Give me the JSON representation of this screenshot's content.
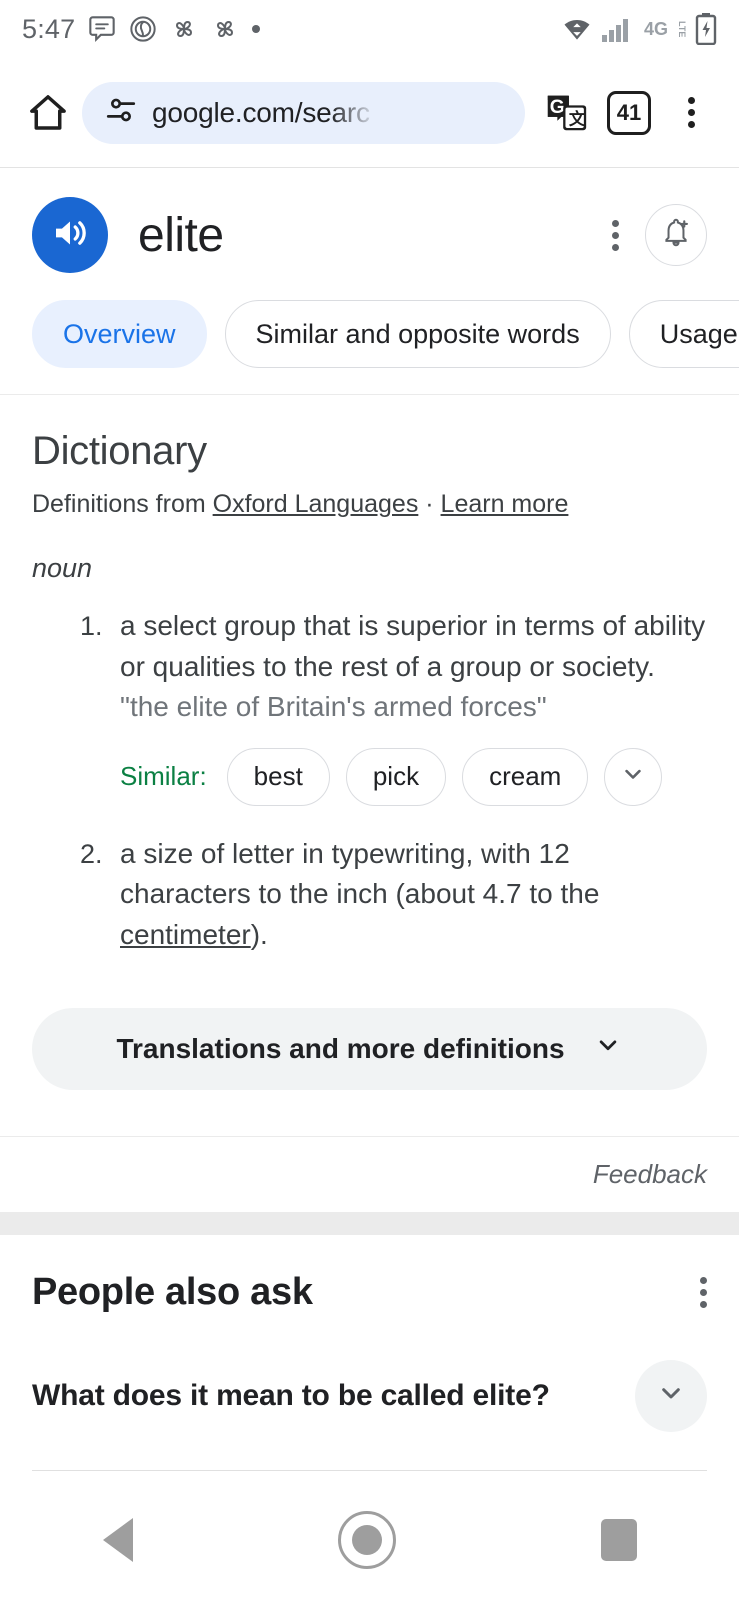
{
  "status_bar": {
    "time": "5:47",
    "left_icons": [
      "message-icon",
      "fingerprint-icon",
      "pinwheel-icon",
      "pinwheel-icon",
      "dot-icon"
    ],
    "network_label": "4G",
    "network_sublabel": "LTE",
    "right_icons": [
      "wifi-icon",
      "signal-icon",
      "battery-charging-icon"
    ]
  },
  "browser": {
    "home_icon": "home-icon",
    "site_settings_icon": "tune-icon",
    "url": "google.com/searc",
    "translate_icon": "google-translate-icon",
    "tab_count": "41",
    "menu_icon": "kebab-menu-icon"
  },
  "word_header": {
    "speak_icon": "speaker-icon",
    "word": "elite",
    "menu_icon": "kebab-menu-icon",
    "notify_icon": "add-alert-bell-icon",
    "accent_color": "#1a67d2"
  },
  "tabs": [
    {
      "label": "Overview",
      "active": true
    },
    {
      "label": "Similar and opposite words",
      "active": false
    },
    {
      "label": "Usage e",
      "active": false
    }
  ],
  "dictionary": {
    "title": "Dictionary",
    "source_prefix": "Definitions from ",
    "source_name": "Oxford Languages",
    "source_separator": " · ",
    "learn_more": "Learn more",
    "part_of_speech": "noun",
    "definitions": [
      {
        "text": "a select group that is superior in terms of ability or qualities to the rest of a group or society.",
        "quote": "\"the elite of Britain's armed forces\""
      },
      {
        "text_before_link": "a size of letter in typewriting, with 12 characters to the inch (about 4.7 to the ",
        "link": "centimeter",
        "text_after_link": ")."
      }
    ],
    "similar_label": "Similar:",
    "similar_terms": [
      "best",
      "pick",
      "cream"
    ],
    "similar_more_icon": "chevron-down-icon",
    "translations_button": "Translations and more definitions",
    "translations_icon": "chevron-down-icon",
    "feedback": "Feedback",
    "similar_label_color": "#0b8043"
  },
  "people_also_ask": {
    "title": "People also ask",
    "menu_icon": "kebab-menu-icon",
    "questions": [
      {
        "text": "What does it mean to be called elite?",
        "expand_icon": "chevron-down-icon"
      }
    ]
  },
  "android_nav": {
    "back": "back-icon",
    "home": "home-circle-icon",
    "recents": "recents-square-icon"
  }
}
